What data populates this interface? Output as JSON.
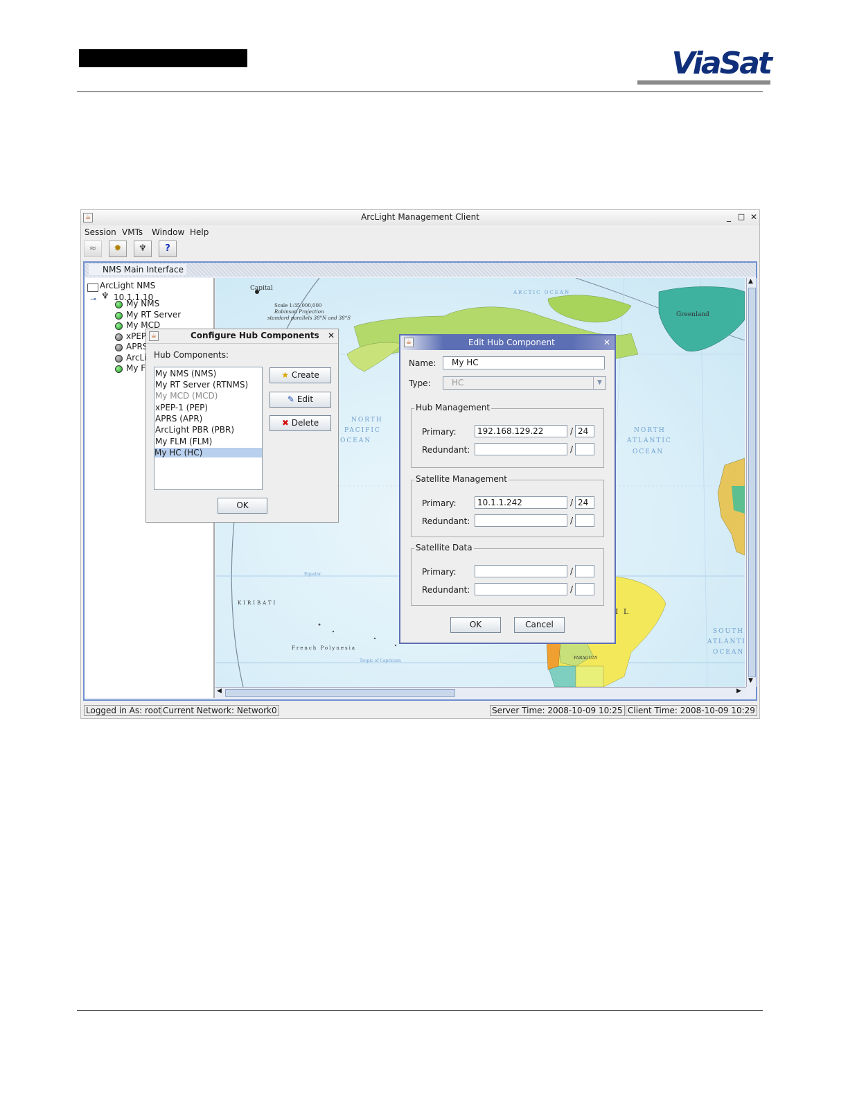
{
  "main_window": {
    "title": "ArcLight Management Client",
    "controls": {
      "minimize": "_",
      "maximize": "□",
      "close": "✕"
    },
    "menu": [
      "Session",
      "VMTs",
      "Window",
      "Help"
    ],
    "toolbar": [
      {
        "icon": "network-disconnect-icon",
        "glyph": "≈"
      },
      {
        "icon": "gear-icon",
        "glyph": "✹"
      },
      {
        "icon": "satellite-dish-icon",
        "glyph": "♆"
      },
      {
        "icon": "help-icon",
        "glyph": "?"
      }
    ]
  },
  "internal_frame": {
    "title": "NMS Main Interface"
  },
  "tree": {
    "root": "ArcLight NMS",
    "network": "10.1.1.10",
    "items": [
      {
        "label": "My NMS",
        "status": "green"
      },
      {
        "label": "My RT Server",
        "status": "green"
      },
      {
        "label": "My MCD",
        "status": "green"
      },
      {
        "label": "xPEP",
        "status": "gray"
      },
      {
        "label": "APRS",
        "status": "gray"
      },
      {
        "label": "ArcLi",
        "status": "gray"
      },
      {
        "label": "My FL",
        "status": "green"
      }
    ]
  },
  "map": {
    "labels": {
      "greenland": "Greenland",
      "north_pacific_1": "NORTH",
      "north_pacific_2": "PACIFIC",
      "north_pacific_3": "OCEAN",
      "north_atlantic_1": "NORTH",
      "north_atlantic_2": "ATLANTIC",
      "north_atlantic_3": "OCEAN",
      "south_atlantic_1": "SOUTH",
      "south_atlantic_2": "ATLANTIC",
      "south_atlantic_3": "OCEAN",
      "kiribati": "KIRIBATI",
      "french_polynesia": "French Polynesia",
      "arctic_ocean": "ARCTIC OCEAN",
      "capital": "Capital",
      "scale": "Scale 1:35,000,000",
      "projection": "Robinson Projection",
      "parallels": "standard parallels 38°N and 38°S",
      "brazil_fragment": "I L",
      "paraguay": "PARAGUAY",
      "equator": "Equator",
      "tropic": "Tropic of Capricorn"
    }
  },
  "status_bar": {
    "logged_in": "Logged in As: root",
    "network": "Current Network: Network0",
    "server_time": "Server Time: 2008-10-09 10:25",
    "client_time": "Client Time: 2008-10-09 10:29"
  },
  "configure_dialog": {
    "title": "Configure Hub Components",
    "close": "✕",
    "list_label": "Hub Components:",
    "components": [
      {
        "label": "My NMS (NMS)",
        "disabled": false,
        "selected": false
      },
      {
        "label": "My RT Server (RTNMS)",
        "disabled": false,
        "selected": false
      },
      {
        "label": "My MCD (MCD)",
        "disabled": true,
        "selected": false
      },
      {
        "label": "xPEP-1 (PEP)",
        "disabled": false,
        "selected": false
      },
      {
        "label": "APRS (APR)",
        "disabled": false,
        "selected": false
      },
      {
        "label": "ArcLight PBR (PBR)",
        "disabled": false,
        "selected": false
      },
      {
        "label": "My FLM (FLM)",
        "disabled": false,
        "selected": false
      },
      {
        "label": "My HC (HC)",
        "disabled": false,
        "selected": true
      }
    ],
    "buttons": {
      "create": "Create",
      "edit": "Edit",
      "delete": "Delete",
      "ok": "OK"
    },
    "icons": {
      "create": "★",
      "edit": "✎",
      "delete": "✖"
    }
  },
  "edit_dialog": {
    "title": "Edit Hub Component",
    "close": "✕",
    "name_label": "Name:",
    "name_value": "My HC",
    "type_label": "Type:",
    "type_value": "HC",
    "sections": {
      "hub_management": {
        "title": "Hub Management",
        "primary_label": "Primary:",
        "primary_ip": "192.168.129.22",
        "primary_mask": "24",
        "redundant_label": "Redundant:",
        "redundant_ip": "",
        "redundant_mask": ""
      },
      "satellite_management": {
        "title": "Satellite Management",
        "primary_label": "Primary:",
        "primary_ip": "10.1.1.242",
        "primary_mask": "24",
        "redundant_label": "Redundant:",
        "redundant_ip": "",
        "redundant_mask": ""
      },
      "satellite_data": {
        "title": "Satellite Data",
        "primary_label": "Primary:",
        "primary_ip": "",
        "primary_mask": "",
        "redundant_label": "Redundant:",
        "redundant_ip": "",
        "redundant_mask": ""
      }
    },
    "slash": "/",
    "buttons": {
      "ok": "OK",
      "cancel": "Cancel"
    }
  },
  "brand": {
    "logo_text": "ViaSat",
    "logo_color": "#0f2f7a"
  },
  "colors": {
    "selection": "#b8cfee",
    "frame_border": "#6f8fcf",
    "dialog_title": "#5c6fb4"
  }
}
